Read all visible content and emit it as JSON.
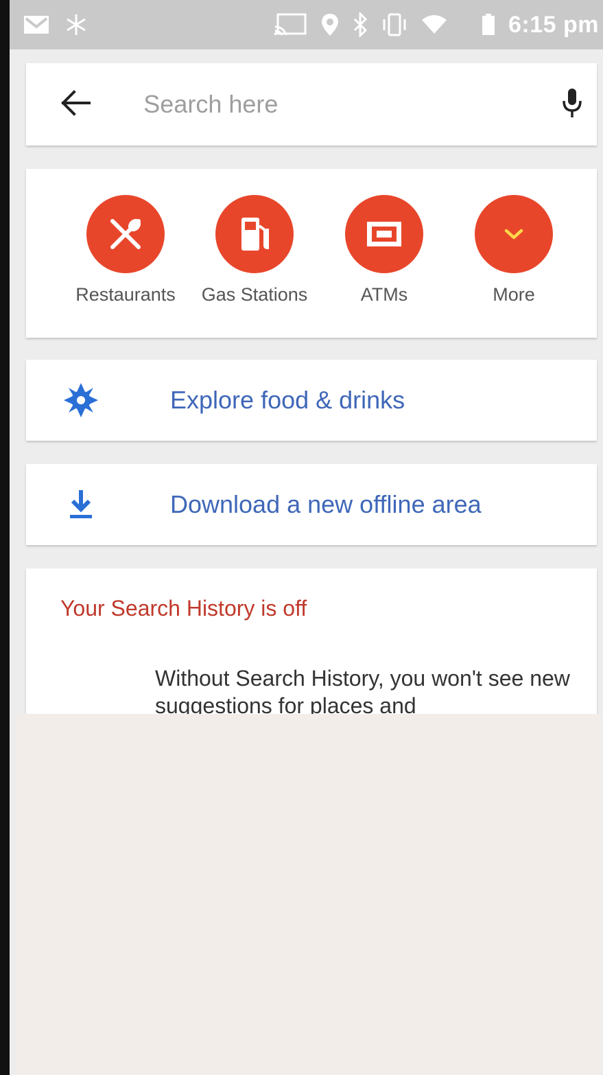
{
  "status_bar": {
    "time": "6:15 pm",
    "left_icons": [
      "gmail-icon",
      "snowflake-icon"
    ],
    "right_icons": [
      "cast-icon",
      "location-pin-icon",
      "bluetooth-icon",
      "vibrate-icon",
      "wifi-icon",
      "battery-icon"
    ]
  },
  "search": {
    "placeholder": "Search here",
    "back_icon": "arrow-left-icon",
    "mic_icon": "microphone-icon"
  },
  "categories": [
    {
      "label": "Restaurants",
      "icon": "fork-spoon-icon"
    },
    {
      "label": "Gas Stations",
      "icon": "gas-pump-icon"
    },
    {
      "label": "ATMs",
      "icon": "atm-icon"
    },
    {
      "label": "More",
      "icon": "chevron-down-icon"
    }
  ],
  "rows": {
    "explore": {
      "label": "Explore food & drinks",
      "icon": "explore-compass-icon"
    },
    "download": {
      "label": "Download a new offline area",
      "icon": "download-icon"
    }
  },
  "history": {
    "title": "Your Search History is off",
    "text": "Without Search History, you won't see new suggestions for places and"
  },
  "colors": {
    "accent_red": "#e8462b",
    "link_blue": "#3f67b8",
    "icon_blue": "#2a6fd6",
    "warning_red": "#c0392b"
  }
}
